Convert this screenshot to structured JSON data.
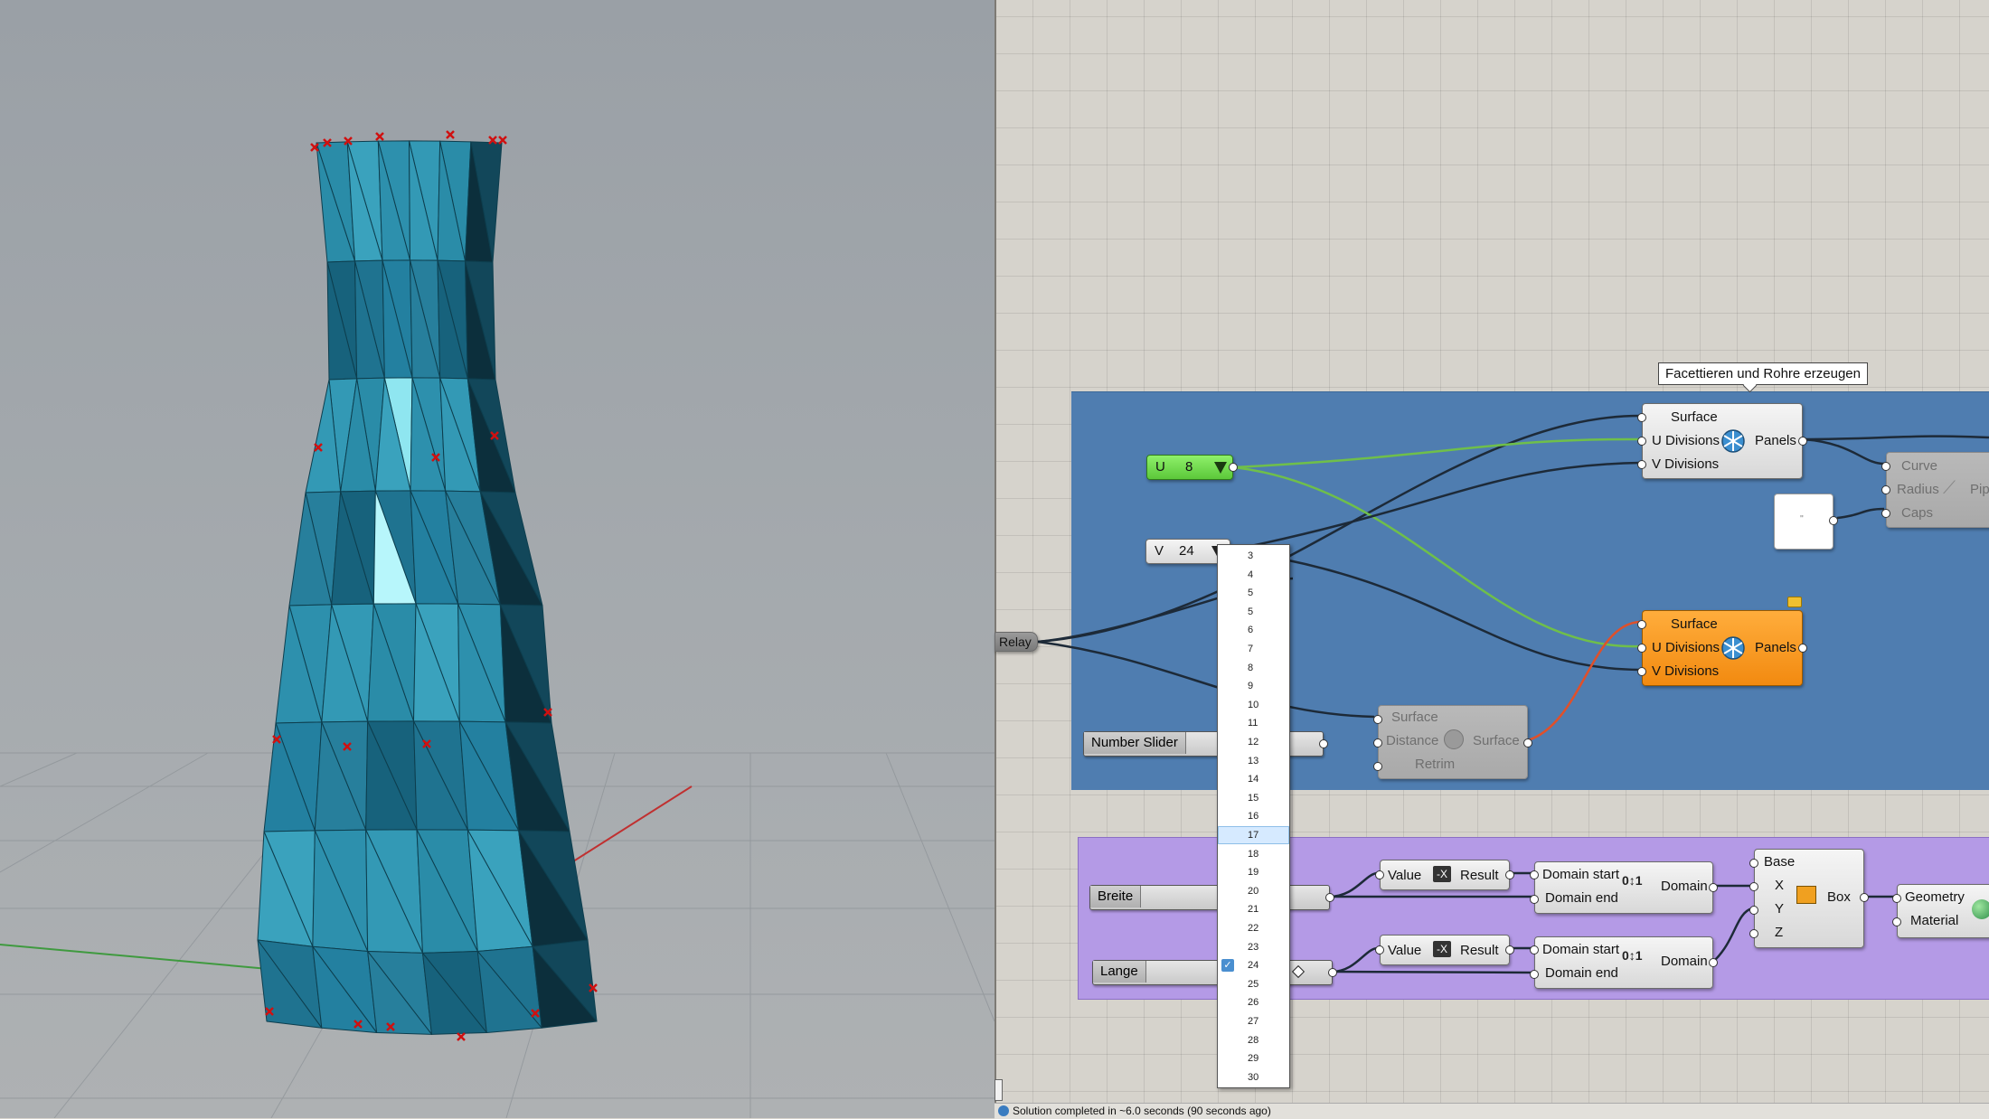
{
  "canvas": {
    "tooltip": "Facettieren und Rohre erzeugen",
    "relay_label": "Relay",
    "u_param": {
      "label": "U",
      "value": "8"
    },
    "v_param": {
      "label": "V",
      "value": "24"
    },
    "panel_note": "''",
    "facet_top": {
      "inputs": [
        "Surface",
        "U Divisions",
        "V Divisions"
      ],
      "output": "Panels"
    },
    "facet_orange": {
      "inputs": [
        "Surface",
        "U Divisions",
        "V Divisions"
      ],
      "output": "Panels"
    },
    "offset_surface": {
      "inputs": [
        "Surface",
        "Distance",
        "Retrim"
      ],
      "output": "Surface"
    },
    "pipe": {
      "inputs": [
        "Curve",
        "Radius",
        "Caps"
      ],
      "output": "Pip"
    },
    "number_slider_label": "Number Slider",
    "breite_label": "Breite",
    "lange_label": "Lange",
    "neg1": {
      "input": "Value",
      "output": "Result"
    },
    "neg2": {
      "input": "Value",
      "output": "Result"
    },
    "domain1": {
      "inputs": [
        "Domain start",
        "Domain end"
      ],
      "output": "Domain"
    },
    "domain2": {
      "inputs": [
        "Domain start",
        "Domain end"
      ],
      "output": "Domain"
    },
    "box": {
      "inputs": [
        "Base",
        "X",
        "Y",
        "Z"
      ],
      "output": "Box"
    },
    "custom_preview": {
      "inputs": [
        "Geometry",
        "Material"
      ]
    }
  },
  "dropdown": {
    "options": [
      "3",
      "4",
      "5",
      "5",
      "6",
      "7",
      "8",
      "9",
      "10",
      "11",
      "12",
      "13",
      "14",
      "15",
      "16",
      "17",
      "18",
      "19",
      "20",
      "21",
      "22",
      "23",
      "24",
      "25",
      "26",
      "27",
      "28",
      "29",
      "30"
    ],
    "hovered": "17",
    "checked": "24"
  },
  "status": {
    "message": "Solution completed in ~6.0 seconds (90 seconds ago)"
  },
  "colors": {
    "group_blue": "#4f7db0",
    "group_purple": "#b49ae6",
    "mesh": "#2a8ca8",
    "wire_green": "#6fbf4a",
    "wire_red": "#e0502a",
    "param_green": "#7ed957"
  }
}
